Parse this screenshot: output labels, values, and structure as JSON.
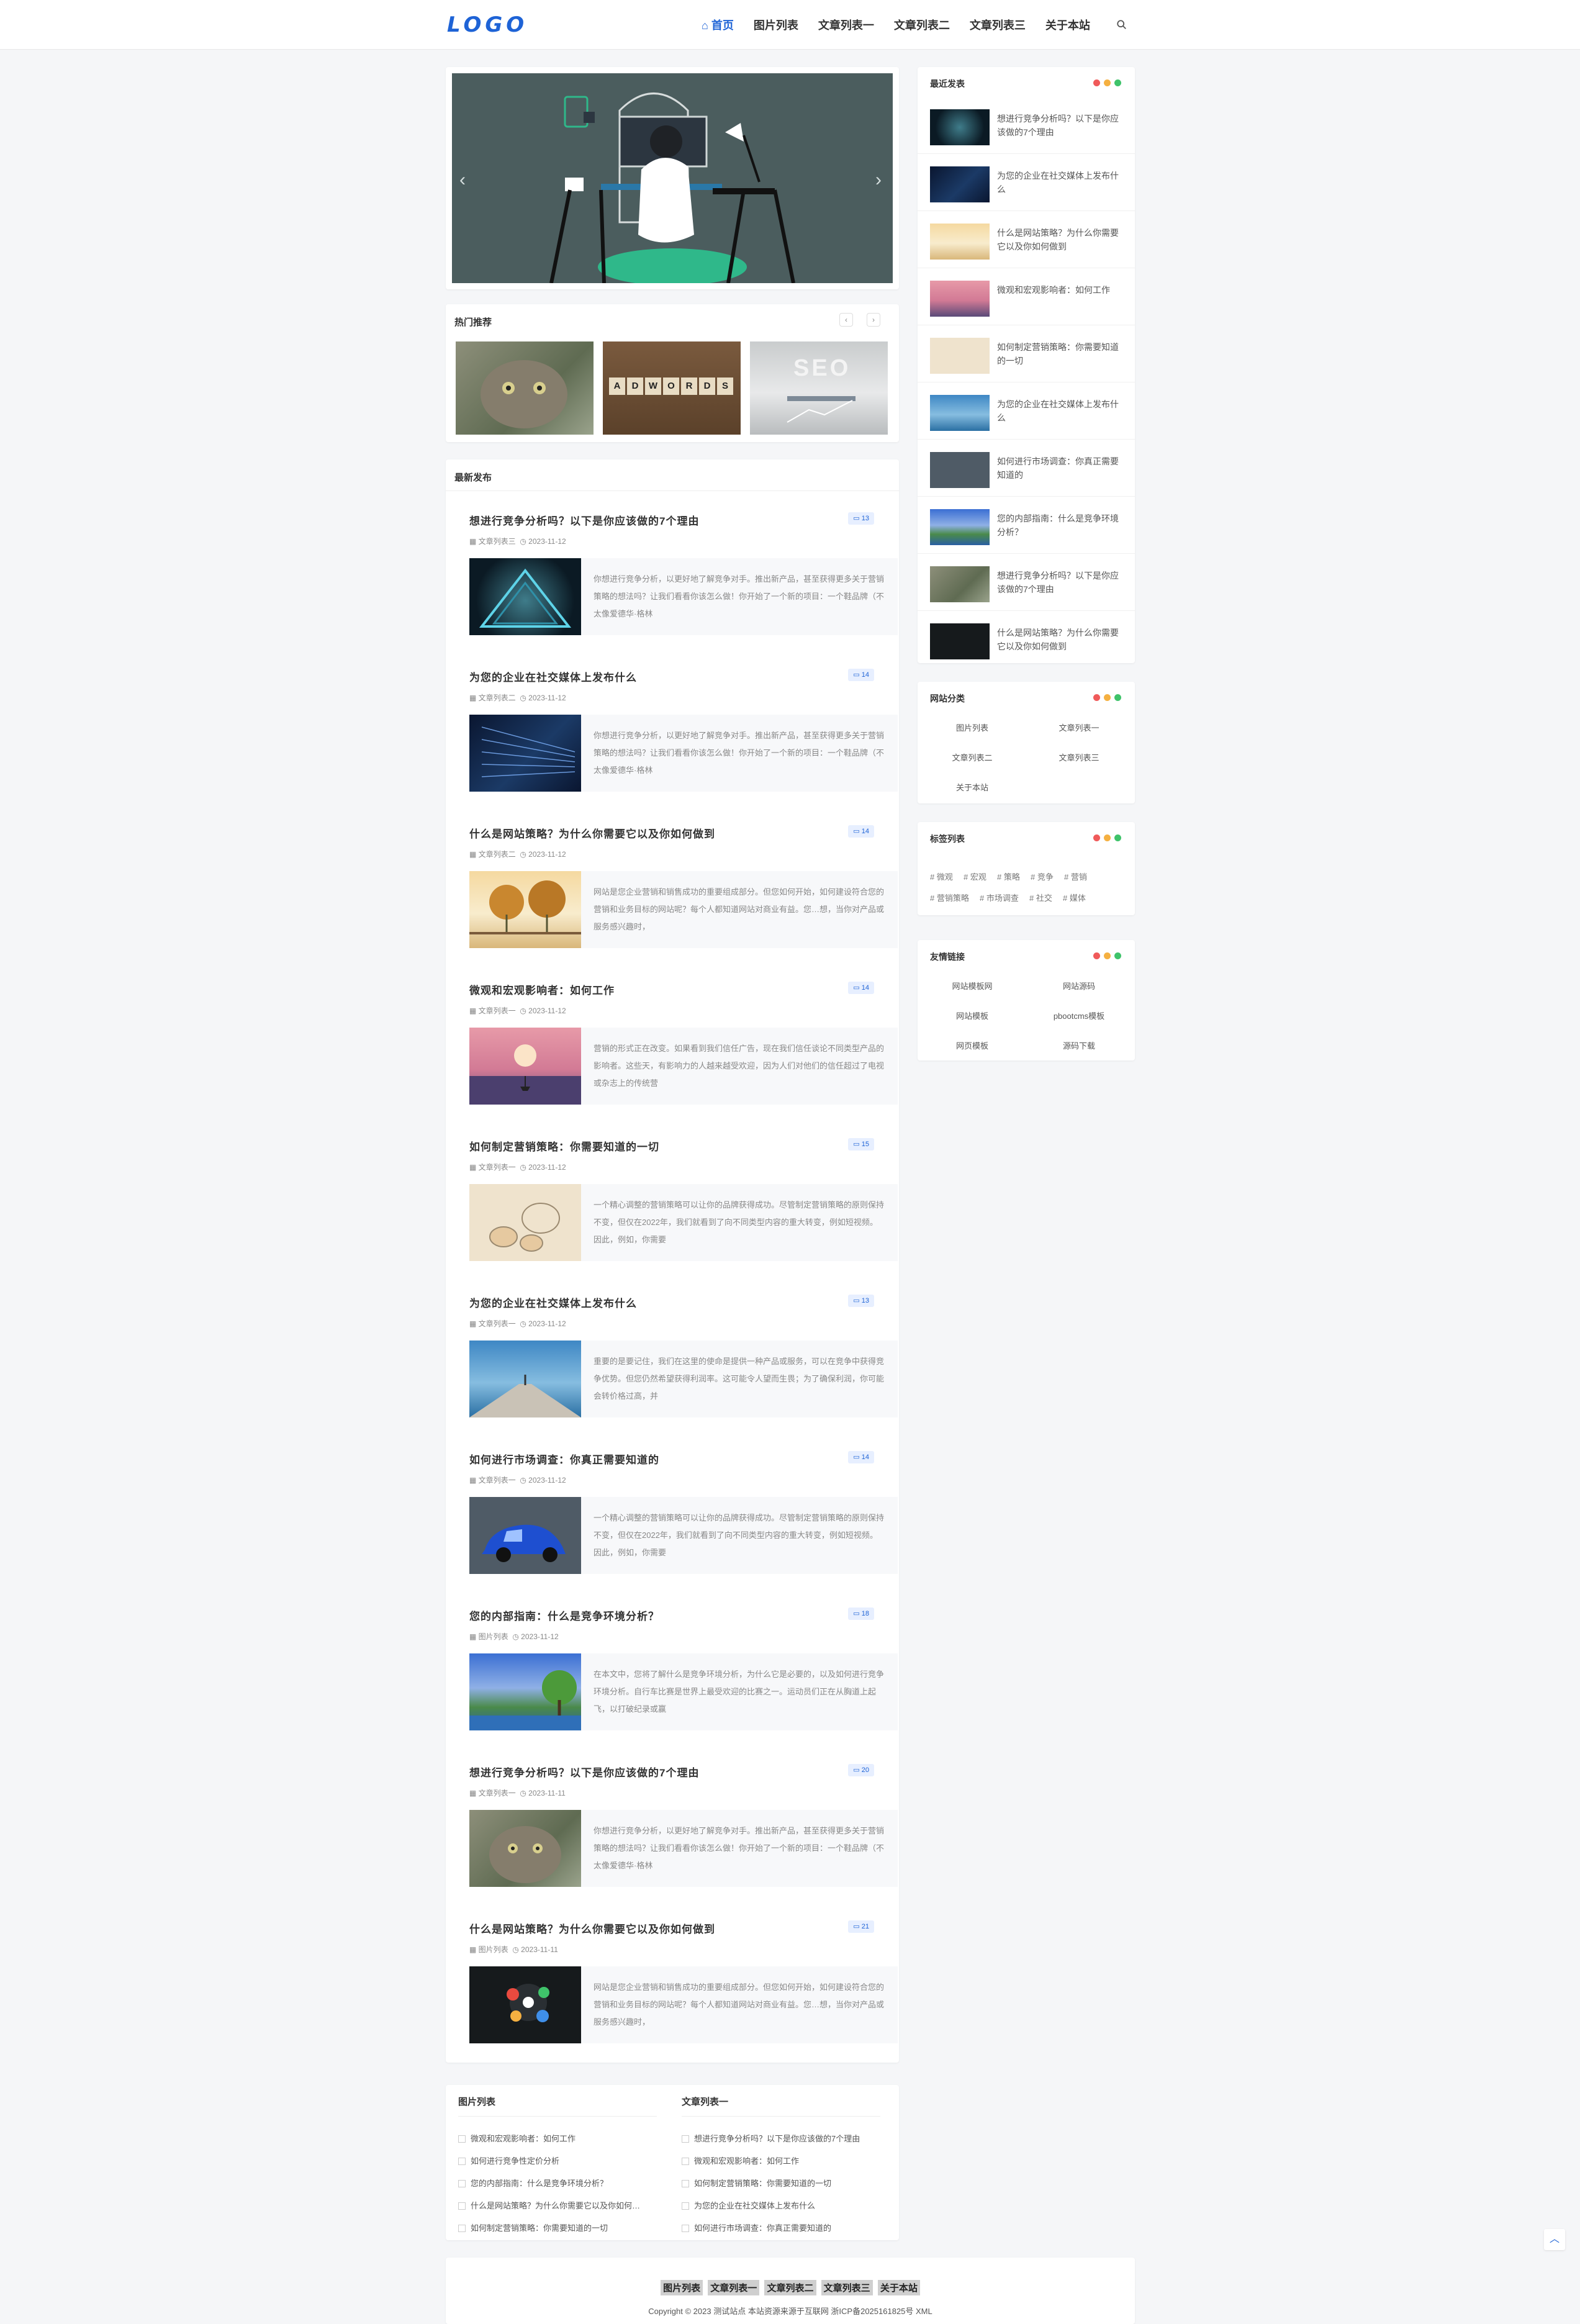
{
  "header": {
    "logo": "LOGO",
    "nav": [
      "首页",
      "图片列表",
      "文章列表一",
      "文章列表二",
      "文章列表三",
      "关于本站"
    ],
    "active_index": 0,
    "search_icon": "search-icon"
  },
  "banner": {
    "prev": "‹",
    "next": "›"
  },
  "hot": {
    "title": "热门推荐",
    "prev": "‹",
    "next": "›",
    "adwords_text": [
      "A",
      "D",
      "W",
      "O",
      "R",
      "D",
      "S"
    ],
    "seo_text": "SEO"
  },
  "latest": {
    "title": "最新发布",
    "posts": [
      {
        "title": "想进行竞争分析吗？以下是你应该做的7个理由",
        "category": "文章列表三",
        "date": "2023-11-12",
        "comments": "13",
        "desc": "你想进行竞争分析，以更好地了解竞争对手。推出新产品，甚至获得更多关于营销策略的想法吗？让我们看看你该怎么做！你开始了一个新的项目：一个鞋品牌（不太像爱德华·格林"
      },
      {
        "title": "为您的企业在社交媒体上发布什么",
        "category": "文章列表二",
        "date": "2023-11-12",
        "comments": "14",
        "desc": "你想进行竞争分析，以更好地了解竞争对手。推出新产品，甚至获得更多关于营销策略的想法吗？让我们看看你该怎么做！你开始了一个新的项目：一个鞋品牌（不太像爱德华·格林"
      },
      {
        "title": "什么是网站策略？为什么你需要它以及你如何做到",
        "category": "文章列表二",
        "date": "2023-11-12",
        "comments": "14",
        "desc": "网站是您企业营销和销售成功的重要组成部分。但您如何开始，如何建设符合您的营销和业务目标的网站呢？每个人都知道网站对商业有益。您…想，当你对产品或服务感兴趣时，"
      },
      {
        "title": "微观和宏观影响者：如何工作",
        "category": "文章列表一",
        "date": "2023-11-12",
        "comments": "14",
        "desc": "营销的形式正在改变。如果看到我们信任广告，现在我们信任谈论不同类型产品的影响者。这些天，有影响力的人越来越受欢迎，因为人们对他们的信任超过了电视或杂志上的传统营"
      },
      {
        "title": "如何制定营销策略：你需要知道的一切",
        "category": "文章列表一",
        "date": "2023-11-12",
        "comments": "15",
        "desc": "一个精心调整的营销策略可以让你的品牌获得成功。尽管制定营销策略的原则保持不变，但仅在2022年，我们就看到了向不同类型内容的重大转变，例如短视频。因此，例如，你需要"
      },
      {
        "title": "为您的企业在社交媒体上发布什么",
        "category": "文章列表一",
        "date": "2023-11-12",
        "comments": "13",
        "desc": "重要的是要记住，我们在这里的使命是提供一种产品或服务，可以在竞争中获得竞争优势。但您仍然希望获得利润率。这可能令人望而生畏；为了确保利润，你可能会转价格过高，并"
      },
      {
        "title": "如何进行市场调查：你真正需要知道的",
        "category": "文章列表一",
        "date": "2023-11-12",
        "comments": "14",
        "desc": "一个精心调整的营销策略可以让你的品牌获得成功。尽管制定营销策略的原则保持不变，但仅在2022年，我们就看到了向不同类型内容的重大转变，例如短视频。因此，例如，你需要"
      },
      {
        "title": "您的内部指南：什么是竞争环境分析？",
        "category": "图片列表",
        "date": "2023-11-12",
        "comments": "18",
        "desc": "在本文中，您将了解什么是竞争环境分析，为什么它是必要的，以及如何进行竞争环境分析。自行车比赛是世界上最受欢迎的比赛之一。运动员们正在从胸道上起飞，以打破纪录或赢"
      },
      {
        "title": "想进行竞争分析吗？以下是你应该做的7个理由",
        "category": "文章列表一",
        "date": "2023-11-11",
        "comments": "20",
        "desc": "你想进行竞争分析，以更好地了解竞争对手。推出新产品，甚至获得更多关于营销策略的想法吗？让我们看看你该怎么做！你开始了一个新的项目：一个鞋品牌（不太像爱德华·格林"
      },
      {
        "title": "什么是网站策略？为什么你需要它以及你如何做到",
        "category": "图片列表",
        "date": "2023-11-11",
        "comments": "21",
        "desc": "网站是您企业营销和销售成功的重要组成部分。但您如何开始，如何建设符合您的营销和业务目标的网站呢？每个人都知道网站对商业有益。您…想，当你对产品或服务感兴趣时，"
      }
    ]
  },
  "recent": {
    "title": "最近发表",
    "items": [
      "想进行竞争分析吗？以下是你应该做的7个理由",
      "为您的企业在社交媒体上发布什么",
      "什么是网站策略？为什么你需要它以及你如何做到",
      "微观和宏观影响者：如何工作",
      "如何制定营销策略：你需要知道的一切",
      "为您的企业在社交媒体上发布什么",
      "如何进行市场调查：你真正需要知道的",
      "您的内部指南：什么是竞争环境分析？",
      "想进行竞争分析吗？以下是你应该做的7个理由",
      "什么是网站策略？为什么你需要它以及你如何做到"
    ]
  },
  "categories": {
    "title": "网站分类",
    "items": [
      "图片列表",
      "文章列表一",
      "文章列表二",
      "文章列表三",
      "关于本站"
    ]
  },
  "tags": {
    "title": "标签列表",
    "items": [
      "# 微观",
      "# 宏观",
      "# 策略",
      "# 竞争",
      "# 营销",
      "# 营销策略",
      "# 市场调查",
      "# 社交",
      "# 媒体"
    ]
  },
  "friends": {
    "title": "友情链接",
    "items": [
      "网站模板网",
      "网站源码",
      "网站模板",
      "pbootcms模板",
      "网页模板",
      "源码下载"
    ]
  },
  "bottom": {
    "col1": {
      "title": "图片列表",
      "items": [
        "微观和宏观影响者：如何工作",
        "如何进行竞争性定价分析",
        "您的内部指南：什么是竞争环境分析？",
        "什么是网站策略？为什么你需要它以及你如何…",
        "如何制定营销策略：你需要知道的一切"
      ]
    },
    "col2": {
      "title": "文章列表一",
      "items": [
        "想进行竞争分析吗？以下是你应该做的7个理由",
        "微观和宏观影响者：如何工作",
        "如何制定营销策略：你需要知道的一切",
        "为您的企业在社交媒体上发布什么",
        "如何进行市场调查：你真正需要知道的"
      ]
    }
  },
  "footer": {
    "links": [
      "图片列表",
      "文章列表一",
      "文章列表二",
      "文章列表三",
      "关于本站"
    ],
    "copyright": "Copyright © 2023 测试站点 本站资源来源于互联网 浙ICP备2025161825号 XML"
  },
  "colors": {
    "accent": "#1e63d6",
    "dot_red": "#f05a5a",
    "dot_orange": "#f5b041",
    "dot_green": "#3fc36a"
  }
}
